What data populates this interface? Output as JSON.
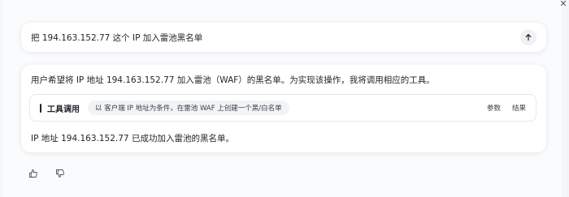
{
  "prompt": {
    "text": "把 194.163.152.77 这个 IP 加入雷池黑名单",
    "send_icon": "arrow-up-icon"
  },
  "reply": {
    "intro": "用户希望将 IP 地址 194.163.152.77 加入雷池（WAF）的黑名单。为实现该操作，我将调用相应的工具。",
    "tool_call": {
      "title": "工具调用",
      "description": "以 客户端 IP 地址为条件，在雷池 WAF 上创建一个黑/白名单",
      "params_label": "参数",
      "result_label": "结果"
    },
    "result": "IP 地址 194.163.152.77 已成功加入雷池的黑名单。"
  },
  "feedback": {
    "like_icon": "thumbs-up-icon",
    "dislike_icon": "thumbs-down-icon"
  },
  "colors": {
    "background": "#f4f5f8",
    "card": "#ffffff",
    "text": "#1f2329",
    "chip": "#f2f3f5"
  }
}
